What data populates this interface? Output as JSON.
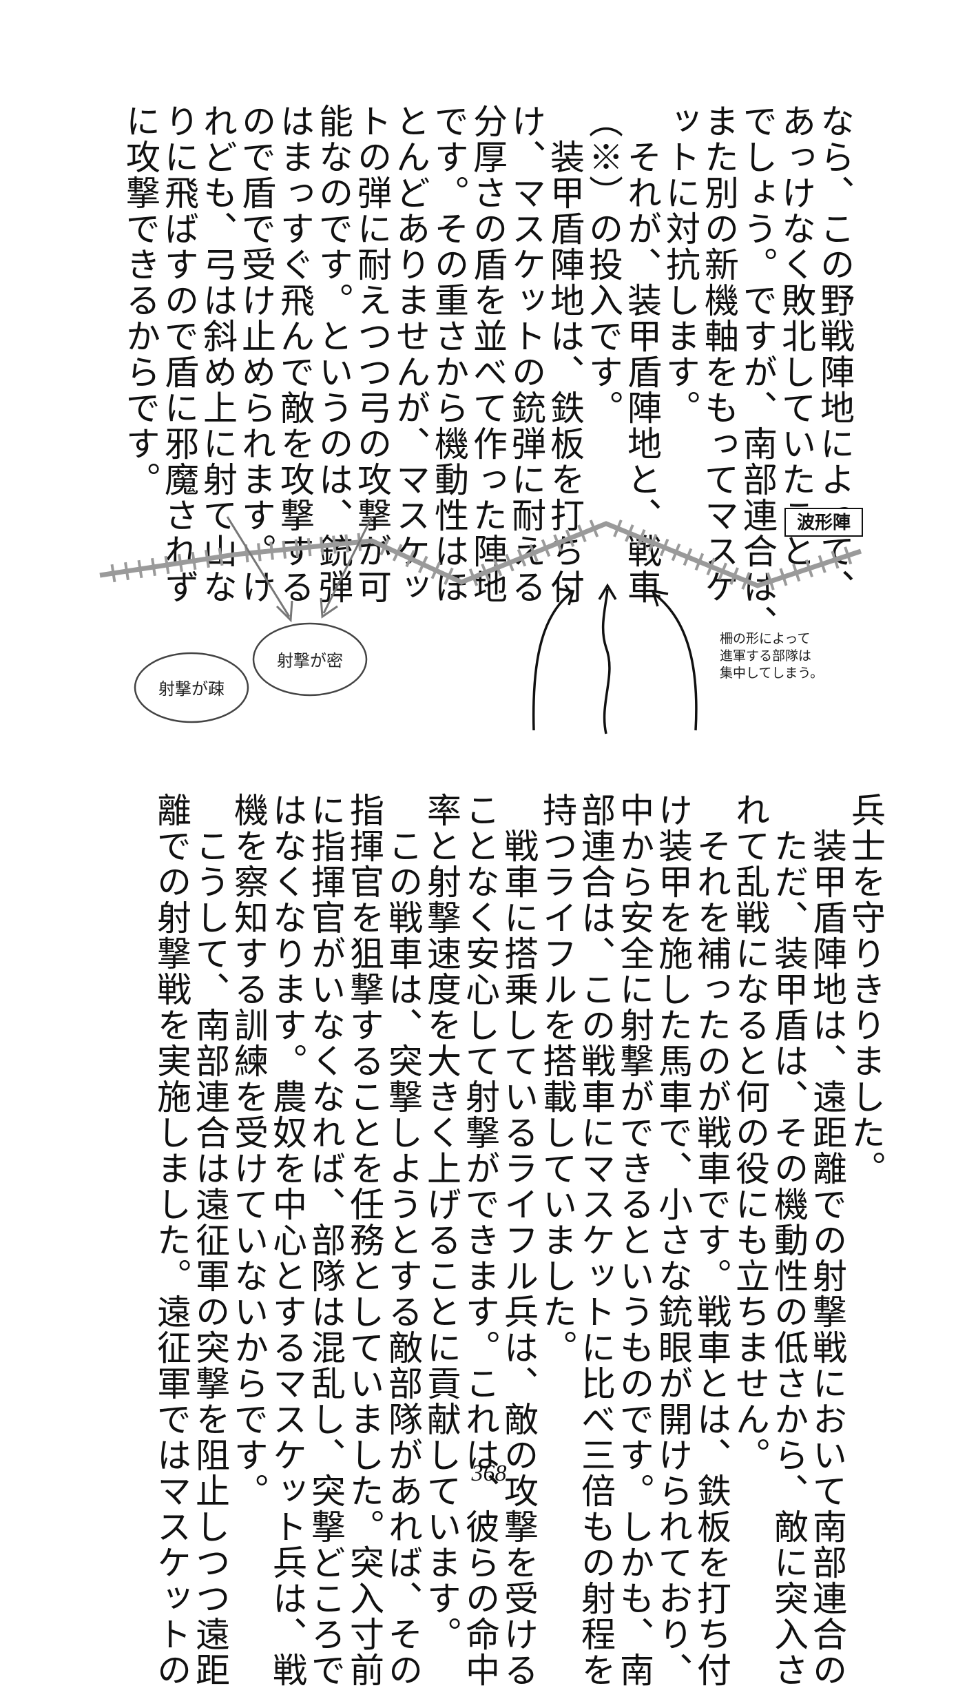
{
  "top_text": {
    "lines": [
      "なら、この野戦陣地によって、",
      "あっけなく敗北していたこと",
      "でしょう。ですが、南部連合は、",
      "また別の新機軸をもってマスケ",
      "ットに対抗します。",
      "　それが、装甲盾陣地と、戦車",
      "（※）の投入です。",
      "　装甲盾陣地は、鉄板を打ち付",
      "け、マスケットの銃弾に耐える",
      "分厚さの盾を並べて作った陣地",
      "です。その重さから機動性はほ",
      "とんどありませんが、マスケッ",
      "トの弾に耐えつつ弓の攻撃が可",
      "能なのです。というのは、銃弾",
      "はまっすぐ飛んで敵を攻撃する",
      "ので盾で受け止められます。け",
      "れども、弓は斜め上に射て山な",
      "りに飛ばすので盾に邪魔されず",
      "に攻撃できるからです。"
    ]
  },
  "diagram": {
    "title": "波形陣",
    "label_dense": "射撃が密",
    "label_sparse": "射撃が疎",
    "note_lines": [
      "柵の形によって",
      "進軍する部隊は",
      "集中してしまう。"
    ]
  },
  "bottom_text": {
    "lines": [
      "兵士を守りきりました。",
      "　装甲盾陣地は、遠距離での射撃戦において南部連合の",
      "　ただ、装甲盾は、その機動性の低さから、敵に突入さ",
      "れて乱戦になると何の役にも立ちません。",
      "　それを補ったのが戦車です。戦車とは、鉄板を打ち付",
      "け装甲を施した馬車で、小さな銃眼が開けられており、",
      "中から安全に射撃ができるというものです。しかも、南",
      "部連合は、この戦車にマスケットに比べ三倍もの射程を",
      "持つライフルを搭載していました。",
      "　戦車に搭乗しているライフル兵は、敵の攻撃を受ける",
      "ことなく安心して射撃ができます。これは、彼らの命中",
      "率と射撃速度を大きく上げることに貢献しています。",
      "　この戦車は、突撃しようとする敵部隊があれば、その",
      "指揮官を狙撃することを任務としていました。突入寸前",
      "に指揮官がいなくなれば、部隊は混乱し、突撃どころで",
      "はなくなります。農奴を中心とするマスケット兵は、戦",
      "機を察知する訓練を受けていないからです。",
      "　こうして、南部連合は遠征軍の突撃を阻止しつつ遠距",
      "離での射撃戦を実施しました。遠征軍ではマスケットの"
    ]
  },
  "page_number": "368"
}
